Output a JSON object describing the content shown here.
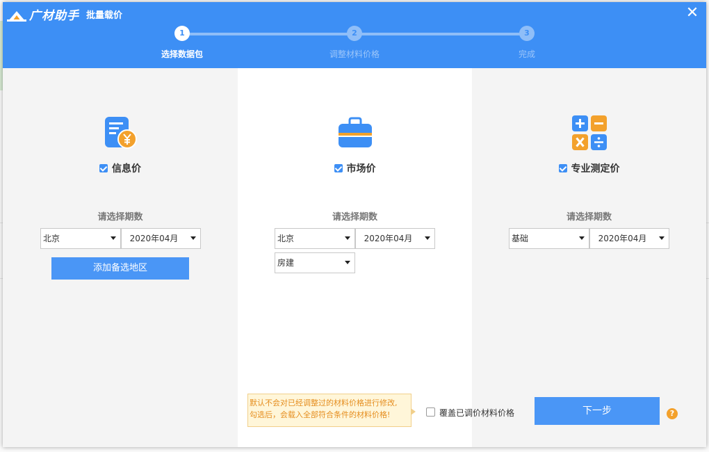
{
  "header": {
    "brand": "广材助手",
    "title": "批量载价",
    "close_glyph": "✕"
  },
  "steps": [
    {
      "num": "1",
      "label": "选择数据包"
    },
    {
      "num": "2",
      "label": "调整材料价格"
    },
    {
      "num": "3",
      "label": "完成"
    }
  ],
  "colors": {
    "accent": "#3d8ff5",
    "orange": "#f3a12c"
  },
  "columns": {
    "info": {
      "icon": "receipt-yen-icon",
      "check_label": "信息价",
      "checked": true,
      "period_label": "请选择期数",
      "region": "北京",
      "period": "2020年04月",
      "add_region": "添加备选地区"
    },
    "market": {
      "icon": "briefcase-icon",
      "check_label": "市场价",
      "checked": true,
      "period_label": "请选择期数",
      "region": "北京",
      "period": "2020年04月",
      "category": "房建"
    },
    "pro": {
      "icon": "calculator-icon",
      "check_label": "专业测定价",
      "checked": true,
      "period_label": "请选择期数",
      "base": "基础",
      "period": "2020年04月"
    }
  },
  "footer": {
    "tooltip_line1": "默认不会对已经调整过的材料价格进行修改,",
    "tooltip_line2": "勾选后，会载入全部符合条件的材料价格!",
    "overwrite_label": "覆盖已调价材料价格",
    "overwrite_checked": false,
    "next_label": "下一步",
    "help_glyph": "?"
  }
}
